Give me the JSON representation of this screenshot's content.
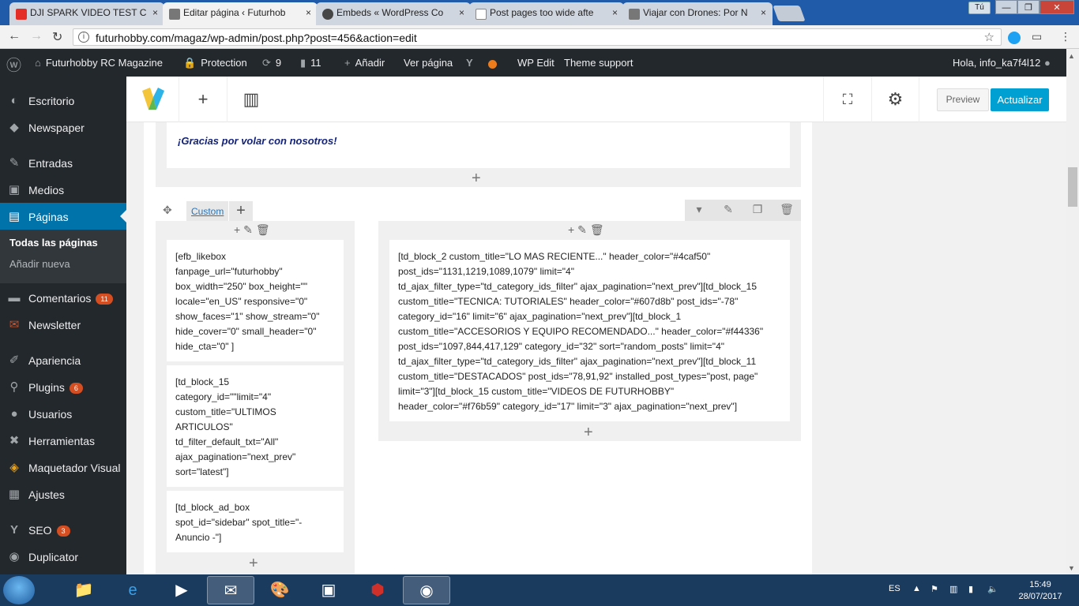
{
  "browser": {
    "tabs": [
      {
        "label": "DJI SPARK VIDEO TEST C",
        "icon": "youtube-icon",
        "color": "#e52d27"
      },
      {
        "label": "Editar página ‹ Futurhob",
        "icon": "camera-icon",
        "color": "#555555"
      },
      {
        "label": "Embeds « WordPress Co",
        "icon": "wordpress-icon",
        "color": "#464646"
      },
      {
        "label": "Post pages too wide afte",
        "icon": "document-icon",
        "color": "#888888"
      },
      {
        "label": "Viajar con Drones: Por N",
        "icon": "camera-icon",
        "color": "#555555"
      }
    ],
    "tab_close": "×",
    "user_button": "Tú",
    "window": {
      "minimize": "—",
      "maximize": "❐",
      "close": "✕"
    },
    "nav": {
      "back": "←",
      "forward": "→",
      "reload": "↻"
    },
    "url": "futurhobby.com/magaz/wp-admin/post.php?post=456&action=edit",
    "info": "i",
    "star": "☆",
    "menu": "⋮"
  },
  "adminbar": {
    "wp_logo": "ⓦ",
    "site": "Futurhobby RC Magazine",
    "protection": "Protection",
    "updates": "9",
    "comments": "11",
    "add": "Añadir",
    "view": "Ver página",
    "wp_edit": "WP Edit",
    "theme_support": "Theme support",
    "greeting": "Hola, info_ka7f4l12"
  },
  "sidebar": {
    "items": [
      {
        "label": "Escritorio",
        "icon": "◐"
      },
      {
        "label": "Newspaper",
        "icon": "◆"
      },
      {
        "label": "Entradas",
        "icon": "✎"
      },
      {
        "label": "Medios",
        "icon": "▣"
      },
      {
        "label": "Páginas",
        "icon": "▤"
      },
      {
        "label": "Comentarios",
        "icon": "▬",
        "badge": "11"
      },
      {
        "label": "Newsletter",
        "icon": "✉"
      },
      {
        "label": "Apariencia",
        "icon": "✐"
      },
      {
        "label": "Plugins",
        "icon": "⚲",
        "badge": "6"
      },
      {
        "label": "Usuarios",
        "icon": "●"
      },
      {
        "label": "Herramientas",
        "icon": "✖"
      },
      {
        "label": "Maquetador Visual",
        "icon": "◈"
      },
      {
        "label": "Ajustes",
        "icon": "▦"
      },
      {
        "label": "SEO",
        "icon": "Y",
        "badge": "3"
      },
      {
        "label": "Duplicator",
        "icon": "◉"
      }
    ],
    "sub": [
      "Todas las páginas",
      "Añadir nueva"
    ]
  },
  "builder": {
    "add": "+",
    "layout": "▥",
    "fullscreen": "⛶",
    "settings": "⚙",
    "preview": "Preview",
    "update": "Actualizar",
    "thanks": "¡Gracias por volar con  nosotros!",
    "row_label": "Custom",
    "row_handle": "✥",
    "col_controls": "+✎🗑",
    "row_controls": {
      "toggle": "▾",
      "edit": "✎",
      "clone": "❐",
      "delete": "🗑"
    },
    "elements": {
      "likebox": "[efb_likebox\nfanpage_url=\"futurhobby\"\nbox_width=\"250\" box_height=\"\"\nlocale=\"en_US\" responsive=\"0\"\nshow_faces=\"1\" show_stream=\"0\"\nhide_cover=\"0\" small_header=\"0\"\nhide_cta=\"0\" ]",
      "block15": "[td_block_15\ncategory_id=\"\"limit=\"4\"\ncustom_title=\"ULTIMOS\nARTICULOS\"\ntd_filter_default_txt=\"All\"\najax_pagination=\"next_prev\"\nsort=\"latest\"]",
      "adbox": "[td_block_ad_box\nspot_id=\"sidebar\" spot_title=\"-\nAnuncio -\"]",
      "main": "[td_block_2 custom_title=\"LO MAS RECIENTE...\" header_color=\"#4caf50\"\npost_ids=\"1131,1219,1089,1079\" limit=\"4\"\ntd_ajax_filter_type=\"td_category_ids_filter\" ajax_pagination=\"next_prev\"][td_block_15\ncustom_title=\"TECNICA: TUTORIALES\" header_color=\"#607d8b\" post_ids=\"-78\"\ncategory_id=\"16\" limit=\"6\" ajax_pagination=\"next_prev\"][td_block_1\ncustom_title=\"ACCESORIOS Y EQUIPO RECOMENDADO...\" header_color=\"#f44336\"\npost_ids=\"1097,844,417,129\" category_id=\"32\" sort=\"random_posts\" limit=\"4\"\ntd_ajax_filter_type=\"td_category_ids_filter\" ajax_pagination=\"next_prev\"][td_block_11\ncustom_title=\"DESTACADOS\" post_ids=\"78,91,92\" installed_post_types=\"post, page\"\nlimit=\"3\"][td_block_15 custom_title=\"VIDEOS DE FUTURHOBBY\"\nheader_color=\"#f76b59\" category_id=\"17\" limit=\"3\" ajax_pagination=\"next_prev\"]"
    }
  },
  "taskbar": {
    "lang": "ES",
    "time": "15:49",
    "date": "28/07/2017"
  },
  "colors": {
    "wp_blue": "#0073aa",
    "update_blue": "#00a0d2",
    "adminbar": "#23282d"
  }
}
